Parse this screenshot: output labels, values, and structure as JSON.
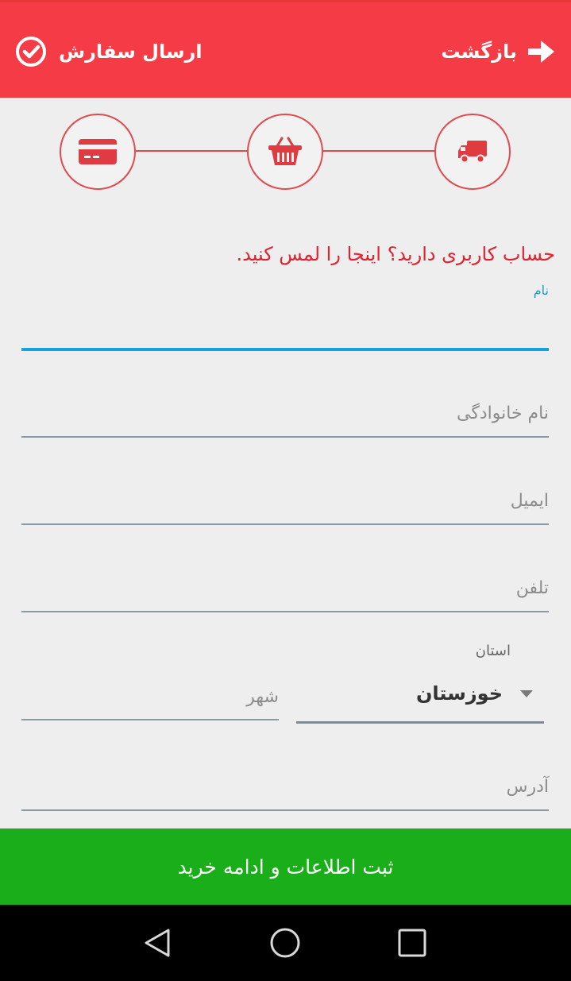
{
  "header": {
    "back_label": "بازگشت",
    "submit_label": "ارسال سفارش",
    "back_icon": "arrow-right-icon",
    "submit_icon": "check-circle-icon",
    "background": "#f53b45"
  },
  "steps": [
    {
      "icon": "card-icon",
      "state": "pending"
    },
    {
      "icon": "basket-icon",
      "state": "pending"
    },
    {
      "icon": "truck-icon",
      "state": "current"
    }
  ],
  "account_prompt": "حساب کاربری دارید؟ اینجا را لمس کنید.",
  "form": {
    "first_name": {
      "label": "نام",
      "value": ""
    },
    "last_name": {
      "placeholder": "نام خانوادگی"
    },
    "email": {
      "placeholder": "ایمیل"
    },
    "phone": {
      "placeholder": "تلفن"
    },
    "province": {
      "label": "استان",
      "value": "خوزستان"
    },
    "city": {
      "placeholder": "شهر"
    },
    "address": {
      "placeholder": "آدرس"
    }
  },
  "cta_label": "ثبت اطلاعات و ادامه خرید",
  "colors": {
    "accent": "#f53b45",
    "focus": "#1aa0dc",
    "cta": "#1aaf1a"
  },
  "nav": [
    "back-icon",
    "home-icon",
    "recents-icon"
  ]
}
